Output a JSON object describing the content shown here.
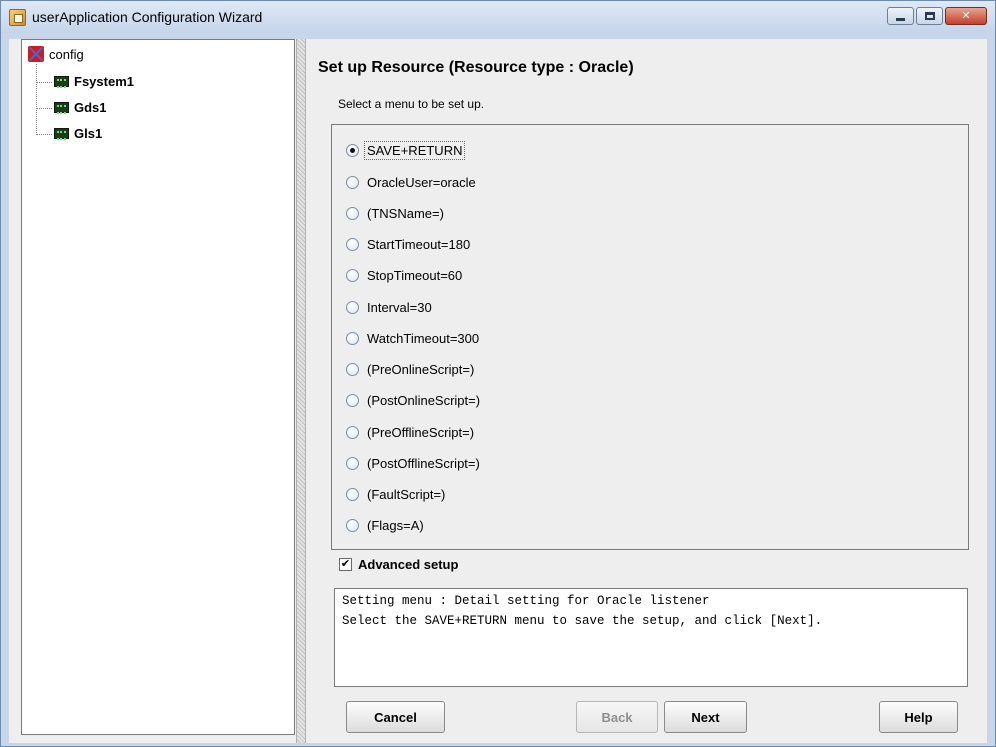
{
  "window": {
    "title": "userApplication Configuration Wizard",
    "controls": {
      "minimize": "minimize",
      "maximize": "maximize",
      "close": "✕"
    }
  },
  "tree": {
    "root": "config",
    "children": [
      "Fsystem1",
      "Gds1",
      "Gls1"
    ]
  },
  "main": {
    "heading": "Set up Resource (Resource type : Oracle)",
    "subheading": "Select a menu to be set up.",
    "menu_items": [
      {
        "label": "SAVE+RETURN",
        "selected": true
      },
      {
        "label": "OracleUser=oracle",
        "selected": false
      },
      {
        "label": "(TNSName=)",
        "selected": false
      },
      {
        "label": "StartTimeout=180",
        "selected": false
      },
      {
        "label": "StopTimeout=60",
        "selected": false
      },
      {
        "label": "Interval=30",
        "selected": false
      },
      {
        "label": "WatchTimeout=300",
        "selected": false
      },
      {
        "label": "(PreOnlineScript=)",
        "selected": false
      },
      {
        "label": "(PostOnlineScript=)",
        "selected": false
      },
      {
        "label": "(PreOfflineScript=)",
        "selected": false
      },
      {
        "label": "(PostOfflineScript=)",
        "selected": false
      },
      {
        "label": "(FaultScript=)",
        "selected": false
      },
      {
        "label": "(Flags=A)",
        "selected": false
      }
    ],
    "advanced_setup": {
      "label": "Advanced setup",
      "checked": true
    },
    "message_lines": [
      "Setting menu : Detail setting for Oracle listener",
      "Select the SAVE+RETURN menu to save the setup, and click [Next]."
    ]
  },
  "buttons": {
    "cancel": "Cancel",
    "back": "Back",
    "next": "Next",
    "help": "Help"
  },
  "colors": {
    "frame": "#c7d6e8",
    "panel_bg": "#eeeeee",
    "close_button": "#c4402a"
  }
}
